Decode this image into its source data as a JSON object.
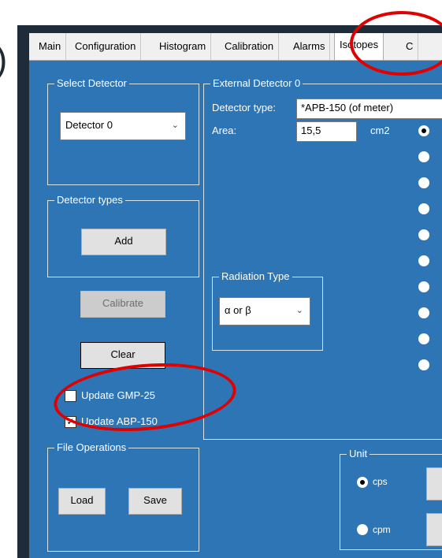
{
  "tabs": [
    "Main",
    "Configuration",
    "Histogram",
    "Calibration",
    "Alarms",
    "Isotopes",
    "C"
  ],
  "active_tab": "Isotopes",
  "select_detector": {
    "title": "Select Detector",
    "value": "Detector 0"
  },
  "detector_types": {
    "title": "Detector types",
    "add_label": "Add"
  },
  "buttons": {
    "calibrate": "Calibrate",
    "clear": "Clear"
  },
  "checkboxes": [
    {
      "label": "Update GMP-25",
      "checked": false
    },
    {
      "label": "Update ABP-150",
      "checked": true
    }
  ],
  "file_operations": {
    "title": "File Operations",
    "load": "Load",
    "save": "Save"
  },
  "external_detector": {
    "title": "External Detector 0",
    "type_label": "Detector type:",
    "type_value": "*APB-150 (of meter)",
    "area_label": "Area:",
    "area_value": "15,5",
    "area_unit": "cm2"
  },
  "radiation_type": {
    "title": "Radiation Type",
    "value": "α or β"
  },
  "unit": {
    "title": "Unit",
    "options": [
      {
        "label": "cps",
        "checked": true
      },
      {
        "label": "cpm",
        "checked": false
      }
    ]
  },
  "colors": {
    "panel_blue": "#2e75b6",
    "annotation_red": "#e00000",
    "window_bg": "#f0f0f0"
  }
}
